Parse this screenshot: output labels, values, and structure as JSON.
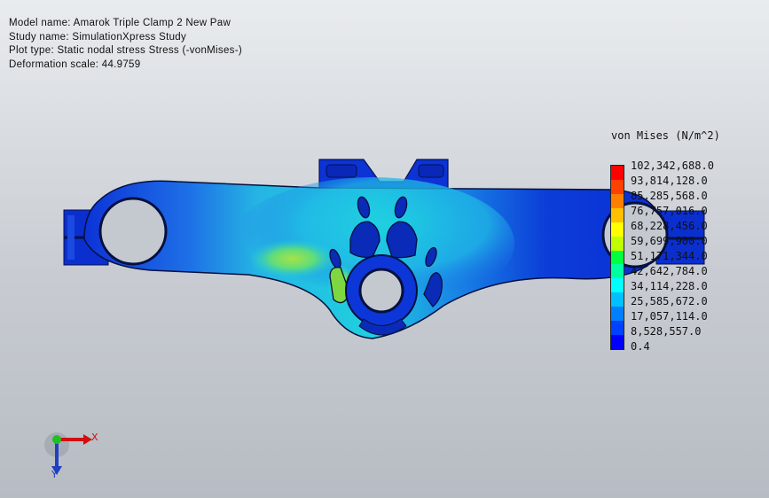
{
  "study_info": {
    "model_name": "Model name: Amarok Triple Clamp 2 New Paw",
    "study_name": "Study name: SimulationXpress Study",
    "plot_type": "Plot type: Static nodal stress Stress (-vonMises-)",
    "deformation_scale": "Deformation scale: 44.9759"
  },
  "legend": {
    "title": "von Mises (N/m^2)",
    "labels": [
      "102,342,688.0",
      "93,814,128.0",
      "85,285,568.0",
      "76,757,016.0",
      "68,228,456.0",
      "59,699,900.0",
      "51,171,344.0",
      "42,642,784.0",
      "34,114,228.0",
      "25,585,672.0",
      "17,057,114.0",
      "8,528,557.0",
      "0.4"
    ],
    "colors": [
      "#ff0000",
      "#ff4000",
      "#ff8000",
      "#ffc000",
      "#ffff00",
      "#c0ff00",
      "#00ff40",
      "#00ffa0",
      "#00ffff",
      "#00c0ff",
      "#0080ff",
      "#0040ff",
      "#0000ff"
    ]
  },
  "triad": {
    "x_label": "X",
    "y_label": "Y"
  },
  "colors": {
    "part_base": "#0a2ed6",
    "stress_mid": "#1fd4e0",
    "stress_high": "#9ae62a"
  }
}
